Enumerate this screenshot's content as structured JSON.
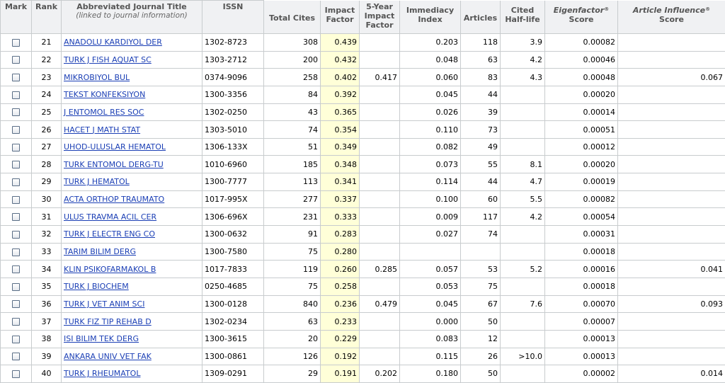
{
  "columns": {
    "mark": "Mark",
    "rank": "Rank",
    "title": "Abbreviated Journal Title",
    "title_note": "(linked to journal information)",
    "issn": "ISSN",
    "total_cites": "Total Cites",
    "impact_factor_1": "Impact",
    "impact_factor_2": "Factor",
    "five_year_1": "5-Year",
    "five_year_2": "Impact",
    "five_year_3": "Factor",
    "immediacy_1": "Immediacy",
    "immediacy_2": "Index",
    "articles": "Articles",
    "half_life_1": "Cited",
    "half_life_2": "Half-life",
    "eigen_1": "Eigenfactor",
    "eigen_2": "Score",
    "influence_1": "Article Influence",
    "influence_2": "Score",
    "registered": "®"
  },
  "rows": [
    {
      "rank": "21",
      "title": "ANADOLU KARDIYOL DER",
      "issn": "1302-8723",
      "total_cites": "308",
      "impact": "0.439",
      "five_year": "",
      "immediacy": "0.203",
      "articles": "118",
      "half_life": "3.9",
      "eigen": "0.00082",
      "influence": ""
    },
    {
      "rank": "22",
      "title": "TURK J FISH AQUAT SC",
      "issn": "1303-2712",
      "total_cites": "200",
      "impact": "0.432",
      "five_year": "",
      "immediacy": "0.048",
      "articles": "63",
      "half_life": "4.2",
      "eigen": "0.00046",
      "influence": ""
    },
    {
      "rank": "23",
      "title": "MIKROBIYOL BUL",
      "issn": "0374-9096",
      "total_cites": "258",
      "impact": "0.402",
      "five_year": "0.417",
      "immediacy": "0.060",
      "articles": "83",
      "half_life": "4.3",
      "eigen": "0.00048",
      "influence": "0.067"
    },
    {
      "rank": "24",
      "title": "TEKST KONFEKSIYON",
      "issn": "1300-3356",
      "total_cites": "84",
      "impact": "0.392",
      "five_year": "",
      "immediacy": "0.045",
      "articles": "44",
      "half_life": "",
      "eigen": "0.00020",
      "influence": ""
    },
    {
      "rank": "25",
      "title": "J ENTOMOL RES SOC",
      "issn": "1302-0250",
      "total_cites": "43",
      "impact": "0.365",
      "five_year": "",
      "immediacy": "0.026",
      "articles": "39",
      "half_life": "",
      "eigen": "0.00014",
      "influence": ""
    },
    {
      "rank": "26",
      "title": "HACET J MATH STAT",
      "issn": "1303-5010",
      "total_cites": "74",
      "impact": "0.354",
      "five_year": "",
      "immediacy": "0.110",
      "articles": "73",
      "half_life": "",
      "eigen": "0.00051",
      "influence": ""
    },
    {
      "rank": "27",
      "title": "UHOD-ULUSLAR HEMATOL",
      "issn": "1306-133X",
      "total_cites": "51",
      "impact": "0.349",
      "five_year": "",
      "immediacy": "0.082",
      "articles": "49",
      "half_life": "",
      "eigen": "0.00012",
      "influence": ""
    },
    {
      "rank": "28",
      "title": "TURK ENTOMOL DERG-TU",
      "issn": "1010-6960",
      "total_cites": "185",
      "impact": "0.348",
      "five_year": "",
      "immediacy": "0.073",
      "articles": "55",
      "half_life": "8.1",
      "eigen": "0.00020",
      "influence": ""
    },
    {
      "rank": "29",
      "title": "TURK J HEMATOL",
      "issn": "1300-7777",
      "total_cites": "113",
      "impact": "0.341",
      "five_year": "",
      "immediacy": "0.114",
      "articles": "44",
      "half_life": "4.7",
      "eigen": "0.00019",
      "influence": ""
    },
    {
      "rank": "30",
      "title": "ACTA ORTHOP TRAUMATO",
      "issn": "1017-995X",
      "total_cites": "277",
      "impact": "0.337",
      "five_year": "",
      "immediacy": "0.100",
      "articles": "60",
      "half_life": "5.5",
      "eigen": "0.00082",
      "influence": ""
    },
    {
      "rank": "31",
      "title": "ULUS TRAVMA ACIL CER",
      "issn": "1306-696X",
      "total_cites": "231",
      "impact": "0.333",
      "five_year": "",
      "immediacy": "0.009",
      "articles": "117",
      "half_life": "4.2",
      "eigen": "0.00054",
      "influence": ""
    },
    {
      "rank": "32",
      "title": "TURK J ELECTR ENG CO",
      "issn": "1300-0632",
      "total_cites": "91",
      "impact": "0.283",
      "five_year": "",
      "immediacy": "0.027",
      "articles": "74",
      "half_life": "",
      "eigen": "0.00031",
      "influence": ""
    },
    {
      "rank": "33",
      "title": "TARIM BILIM DERG",
      "issn": "1300-7580",
      "total_cites": "75",
      "impact": "0.280",
      "five_year": "",
      "immediacy": "",
      "articles": "",
      "half_life": "",
      "eigen": "0.00018",
      "influence": ""
    },
    {
      "rank": "34",
      "title": "KLIN PSIKOFARMAKOL B",
      "issn": "1017-7833",
      "total_cites": "119",
      "impact": "0.260",
      "five_year": "0.285",
      "immediacy": "0.057",
      "articles": "53",
      "half_life": "5.2",
      "eigen": "0.00016",
      "influence": "0.041"
    },
    {
      "rank": "35",
      "title": "TURK J BIOCHEM",
      "issn": "0250-4685",
      "total_cites": "75",
      "impact": "0.258",
      "five_year": "",
      "immediacy": "0.053",
      "articles": "75",
      "half_life": "",
      "eigen": "0.00018",
      "influence": ""
    },
    {
      "rank": "36",
      "title": "TURK J VET ANIM SCI",
      "issn": "1300-0128",
      "total_cites": "840",
      "impact": "0.236",
      "five_year": "0.479",
      "immediacy": "0.045",
      "articles": "67",
      "half_life": "7.6",
      "eigen": "0.00070",
      "influence": "0.093"
    },
    {
      "rank": "37",
      "title": "TURK FIZ TIP REHAB D",
      "issn": "1302-0234",
      "total_cites": "63",
      "impact": "0.233",
      "five_year": "",
      "immediacy": "0.000",
      "articles": "50",
      "half_life": "",
      "eigen": "0.00007",
      "influence": ""
    },
    {
      "rank": "38",
      "title": "ISI BILIM TEK DERG",
      "issn": "1300-3615",
      "total_cites": "20",
      "impact": "0.229",
      "five_year": "",
      "immediacy": "0.083",
      "articles": "12",
      "half_life": "",
      "eigen": "0.00013",
      "influence": ""
    },
    {
      "rank": "39",
      "title": "ANKARA UNIV VET FAK",
      "issn": "1300-0861",
      "total_cites": "126",
      "impact": "0.192",
      "five_year": "",
      "immediacy": "0.115",
      "articles": "26",
      "half_life": ">10.0",
      "eigen": "0.00013",
      "influence": ""
    },
    {
      "rank": "40",
      "title": "TURK J RHEUMATOL",
      "issn": "1309-0291",
      "total_cites": "29",
      "impact": "0.191",
      "five_year": "0.202",
      "immediacy": "0.180",
      "articles": "50",
      "half_life": "",
      "eigen": "0.00002",
      "influence": "0.014"
    }
  ]
}
